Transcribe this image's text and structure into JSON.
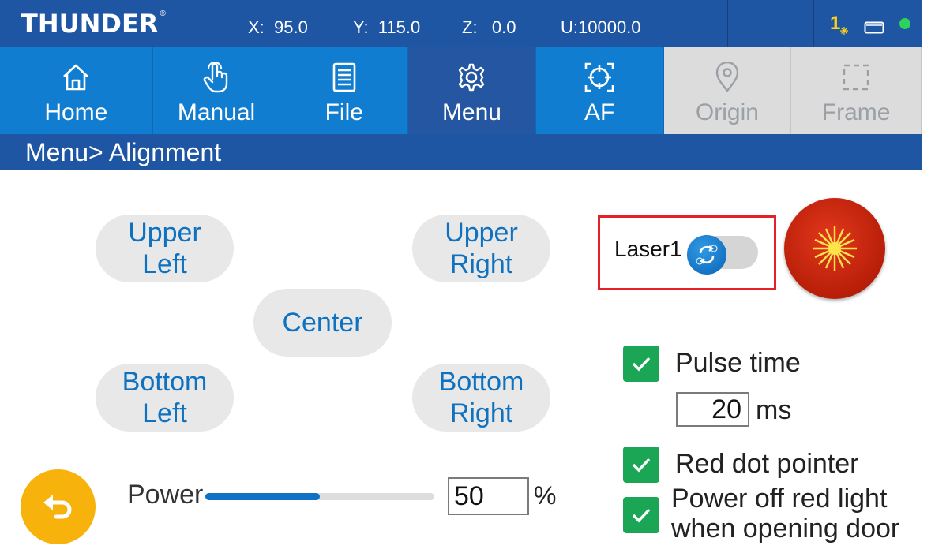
{
  "header": {
    "logo_text": "THUNDER",
    "logo_mark": "®",
    "coords": {
      "x": "X:  95.0",
      "y": "Y:  115.0",
      "z": "Z:   0.0",
      "u": "U:10000.0"
    },
    "laser_index": "1",
    "status_color": "#2ed15a"
  },
  "tabs": [
    {
      "label": "Home",
      "icon": "home-icon",
      "state": "normal"
    },
    {
      "label": "Manual",
      "icon": "hand-pointer-icon",
      "state": "normal"
    },
    {
      "label": "File",
      "icon": "file-list-icon",
      "state": "normal"
    },
    {
      "label": "Menu",
      "icon": "gear-icon",
      "state": "active"
    },
    {
      "label": "AF",
      "icon": "crosshair-icon",
      "state": "normal"
    },
    {
      "label": "Origin",
      "icon": "location-pin-icon",
      "state": "disabled"
    },
    {
      "label": "Frame",
      "icon": "dashed-frame-icon",
      "state": "disabled"
    }
  ],
  "breadcrumb": "Menu> Alignment",
  "alignment": {
    "upper_left": "Upper\nLeft",
    "upper_right": "Upper\nRight",
    "center": "Center",
    "bottom_left": "Bottom\nLeft",
    "bottom_right": "Bottom\nRight"
  },
  "laser_select": {
    "label": "Laser1"
  },
  "options": {
    "pulse_time_label": "Pulse time",
    "pulse_time_value": "20",
    "pulse_time_unit": "ms",
    "pulse_time_checked": true,
    "red_dot_label": "Red dot pointer",
    "red_dot_checked": true,
    "door_label": "Power off red light\nwhen opening door",
    "door_checked": true
  },
  "power": {
    "label": "Power",
    "value": "50",
    "unit": "%",
    "level_percent": 50
  },
  "colors": {
    "header_blue": "#1f56a4",
    "tab_blue": "#117dd0",
    "accent_green": "#1aa655",
    "fire_red": "#c8250e",
    "back_yellow": "#f7b20b"
  }
}
